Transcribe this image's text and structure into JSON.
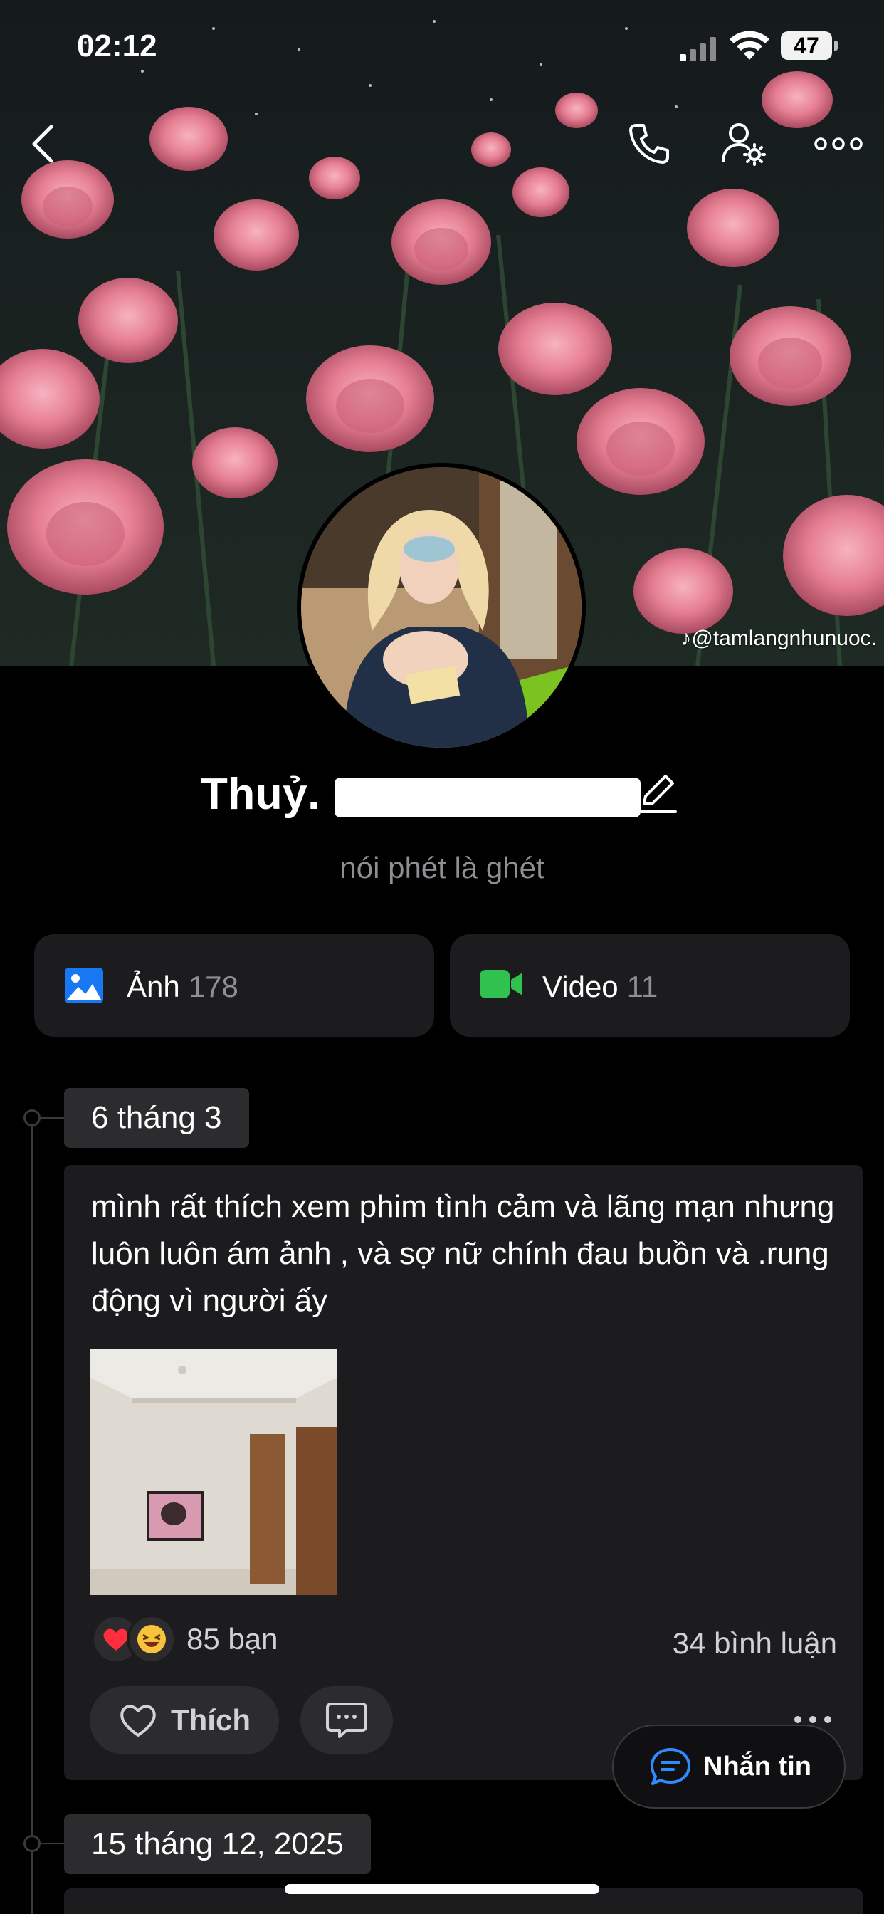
{
  "status_bar": {
    "time": "02:12",
    "battery": "47"
  },
  "cover": {
    "watermark": "@tamlangnhunuoc."
  },
  "profile": {
    "name_visible": "Thuỷ. 0",
    "bio": "nói phét là ghét"
  },
  "media": {
    "photos": {
      "label": "Ảnh",
      "count": "178"
    },
    "videos": {
      "label": "Video",
      "count": "11"
    }
  },
  "timeline": [
    {
      "date": "6 tháng 3",
      "text": "mình rất thích xem phim tình cảm và lãng mạn nhưng luôn luôn ám ảnh , và sợ nữ chính đau buồn và .rung động vì người ấy",
      "reactions": [
        "heart-icon",
        "laughing-emoji-icon"
      ],
      "reaction_count": "85 bạn",
      "comment_count": "34 bình luận",
      "like_label": "Thích"
    },
    {
      "date": "15 tháng 12, 2025"
    }
  ],
  "fab": {
    "label": "Nhắn tin"
  },
  "colors": {
    "background": "#000000",
    "card": "#1c1c1e",
    "photo_icon": "#1877f2",
    "video_icon": "#30c14f",
    "muted_text": "#8e8e93"
  }
}
